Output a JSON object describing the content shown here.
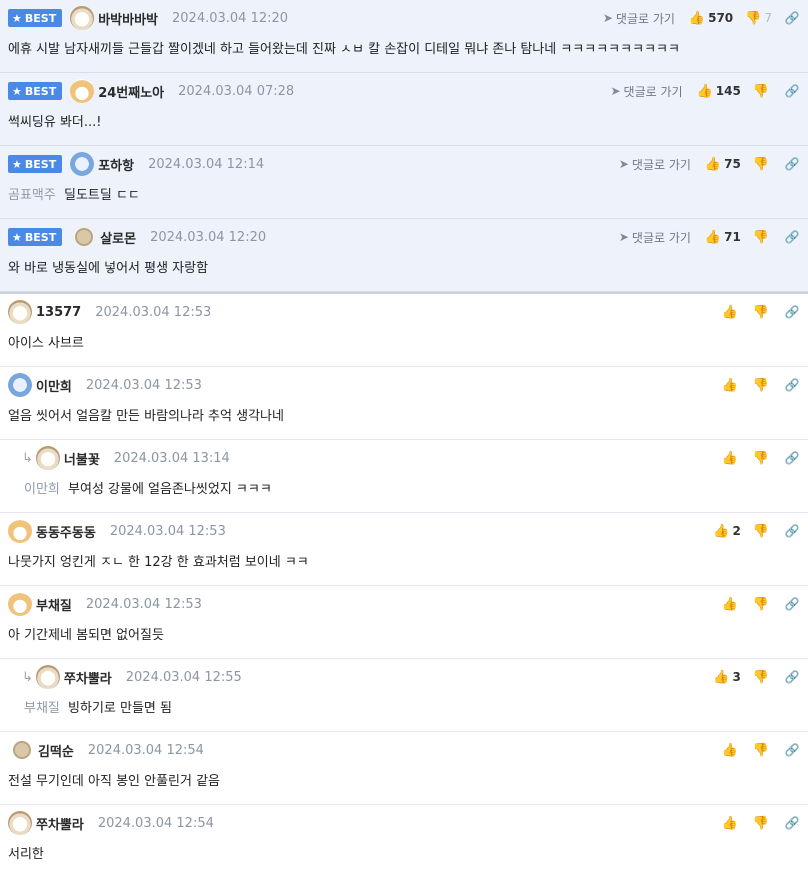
{
  "labels": {
    "best": "BEST",
    "goto": "댓글로 가기"
  },
  "colors": {
    "best_badge": "#4a8ae6",
    "best_background": "#eef3fb",
    "date_text": "#8b96a3"
  },
  "icons": {
    "star": "★",
    "goto_arrow": "➤",
    "thumbs_up": "👍",
    "thumbs_down": "👎",
    "link": "🔗",
    "reply_arrow": "↳"
  },
  "comments": [
    {
      "best": true,
      "reply": false,
      "avatar": "dog",
      "nick": "바박바바박",
      "date": "2024.03.04 12:20",
      "goto": true,
      "up": "570",
      "down": "7",
      "mention": "",
      "text": "에휴 시발 남자새끼들 근들갑 짤이겠네 하고 들어왔는데 진짜 ㅅㅂ 칼 손잡이 디테일 뭐냐 존나 탐나네 ㅋㅋㅋㅋㅋㅋㅋㅋㅋㅋ"
    },
    {
      "best": true,
      "reply": false,
      "avatar": "fox",
      "nick": "24번째노아",
      "date": "2024.03.04 07:28",
      "goto": true,
      "up": "145",
      "down": "",
      "mention": "",
      "text": "썩씨딩유 봐더...!"
    },
    {
      "best": true,
      "reply": false,
      "avatar": "blue",
      "nick": "포하항",
      "date": "2024.03.04 12:14",
      "goto": true,
      "up": "75",
      "down": "",
      "mention": "곰표맥주",
      "text": "딜도트딜 ㄷㄷ"
    },
    {
      "best": true,
      "reply": false,
      "avatar": "beige",
      "nick": "살로몬",
      "date": "2024.03.04 12:20",
      "goto": true,
      "up": "71",
      "down": "",
      "mention": "",
      "text": "와 바로 냉동실에 넣어서 평생 자랑함"
    },
    {
      "best": false,
      "reply": false,
      "avatar": "dog",
      "nick": "13577",
      "date": "2024.03.04 12:53",
      "goto": false,
      "up": "",
      "down": "",
      "mention": "",
      "text": "아이스 사브르"
    },
    {
      "best": false,
      "reply": false,
      "avatar": "blue",
      "nick": "이만희",
      "date": "2024.03.04 12:53",
      "goto": false,
      "up": "",
      "down": "",
      "mention": "",
      "text": "얼음 씻어서 얼음칼 만든 바람의나라 추억 생각나네"
    },
    {
      "best": false,
      "reply": true,
      "avatar": "dog",
      "nick": "너불꽃",
      "date": "2024.03.04 13:14",
      "goto": false,
      "up": "",
      "down": "",
      "mention": "이만희",
      "text": "부여성 강물에 얼음존나씻었지 ㅋㅋㅋ"
    },
    {
      "best": false,
      "reply": false,
      "avatar": "fox",
      "nick": "동동주동동",
      "date": "2024.03.04 12:53",
      "goto": false,
      "up": "2",
      "down": "",
      "mention": "",
      "text": "나뭇가지 엉킨게 ㅈㄴ 한 12강 한 효과처럼 보이네 ㅋㅋ"
    },
    {
      "best": false,
      "reply": false,
      "avatar": "fox",
      "nick": "부채질",
      "date": "2024.03.04 12:53",
      "goto": false,
      "up": "",
      "down": "",
      "mention": "",
      "text": "아 기간제네 봄되면 없어질듯"
    },
    {
      "best": false,
      "reply": true,
      "avatar": "dog",
      "nick": "쭈차뿔라",
      "date": "2024.03.04 12:55",
      "goto": false,
      "up": "3",
      "down": "",
      "mention": "부채질",
      "text": "빙하기로 만들면 됨"
    },
    {
      "best": false,
      "reply": false,
      "avatar": "beige",
      "nick": "김떡순",
      "date": "2024.03.04 12:54",
      "goto": false,
      "up": "",
      "down": "",
      "mention": "",
      "text": "전설 무기인데 아직 봉인 안풀린거 같음"
    },
    {
      "best": false,
      "reply": false,
      "avatar": "dog",
      "nick": "쭈차뿔라",
      "date": "2024.03.04 12:54",
      "goto": false,
      "up": "",
      "down": "",
      "mention": "",
      "text": "서리한"
    }
  ]
}
